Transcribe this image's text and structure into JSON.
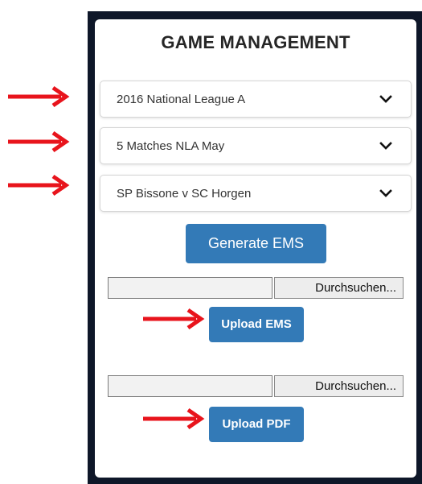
{
  "panel": {
    "title": "GAME MANAGEMENT"
  },
  "selects": {
    "league": {
      "value": "2016 National League A",
      "icon": "chevron-down-icon"
    },
    "match_group": {
      "value": "5 Matches NLA May",
      "icon": "chevron-down-icon"
    },
    "game": {
      "value": "SP Bissone v SC Horgen",
      "icon": "chevron-down-icon"
    }
  },
  "buttons": {
    "generate_ems": "Generate EMS",
    "upload_ems": "Upload EMS",
    "upload_pdf": "Upload PDF"
  },
  "file_inputs": {
    "ems": {
      "browse_label": "Durchsuchen..."
    },
    "pdf": {
      "browse_label": "Durchsuchen..."
    }
  },
  "colors": {
    "accent": "#337ab7",
    "annotation_arrow": "#e8141c",
    "frame": "#0e1729"
  },
  "annotations": {
    "arrow_icon": "red-arrow-icon",
    "count": 5
  }
}
